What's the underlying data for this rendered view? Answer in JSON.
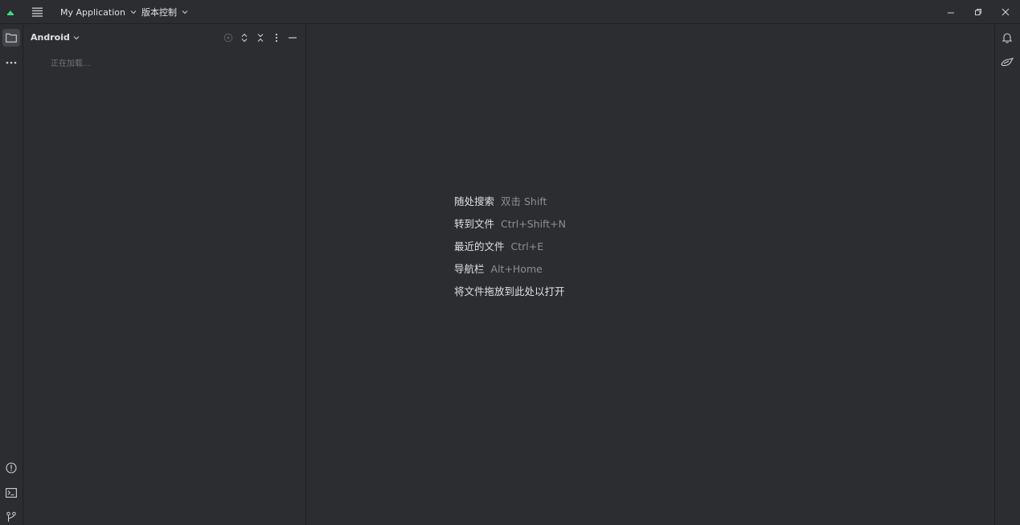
{
  "titlebar": {
    "project_name": "My Application",
    "vcs_label": "版本控制"
  },
  "project_panel": {
    "view_label": "Android",
    "loading_text": "正在加载..."
  },
  "editor": {
    "hints": [
      {
        "action": "随处搜索",
        "shortcut": "双击 Shift"
      },
      {
        "action": "转到文件",
        "shortcut": "Ctrl+Shift+N"
      },
      {
        "action": "最近的文件",
        "shortcut": "Ctrl+E"
      },
      {
        "action": "导航栏",
        "shortcut": "Alt+Home"
      },
      {
        "action": "将文件拖放到此处以打开",
        "shortcut": ""
      }
    ]
  },
  "icons": {
    "app_logo": "android-studio-logo",
    "main_menu": "hamburger-icon",
    "minimize": "minimize-icon",
    "restore": "restore-icon",
    "close": "close-icon",
    "project": "folder-icon",
    "more": "more-horizontal-icon",
    "problems": "problems-icon",
    "terminal": "terminal-icon",
    "git": "git-branch-icon",
    "notifications": "bell-icon",
    "gemini": "ai-assistant-icon"
  },
  "colors": {
    "background": "#2b2d30",
    "text": "#dfe1e5",
    "muted_text": "#8c8f94",
    "icon": "#ced0d6",
    "logo_green": "#3ddc84"
  }
}
